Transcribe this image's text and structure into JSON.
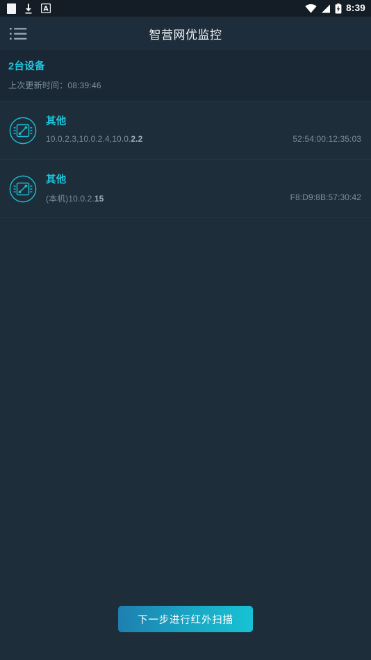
{
  "status_bar": {
    "icons_left": [
      "screenshot-square-icon",
      "download-icon",
      "a-box-icon"
    ],
    "icons_right": [
      "wifi-icon",
      "signal-icon",
      "battery-charging-icon"
    ],
    "time": "8:39"
  },
  "title_bar": {
    "menu_icon": "list-menu-icon",
    "title": "智营网优监控"
  },
  "info_band": {
    "device_count": "2台设备",
    "update_time": "上次更新时间：08:39:46"
  },
  "devices": [
    {
      "icon": "network-device-icon",
      "name": "其他",
      "ip_prefix": "10.0.2.3,10.0.2.4,10.0.",
      "ip_suffix": "2.2",
      "mac": "52:54:00:12:35:03"
    },
    {
      "icon": "network-device-icon",
      "name": "其他",
      "ip_prefix": "(本机)10.0.2.",
      "ip_suffix": "15",
      "mac": "F8:D9:8B:57:30:42"
    }
  ],
  "bottom": {
    "scan_button": "下一步进行红外扫描"
  },
  "colors": {
    "accent_cyan": "#1fc8e0",
    "background": "#1d2d3a",
    "status_bar_bg": "#141d26",
    "title_bar_bg": "#1e2d3b",
    "info_band_bg": "#1a2835",
    "muted_text": "#7d8e9b",
    "button_gradient_start": "#1e7fb0",
    "button_gradient_end": "#17c2d4"
  }
}
